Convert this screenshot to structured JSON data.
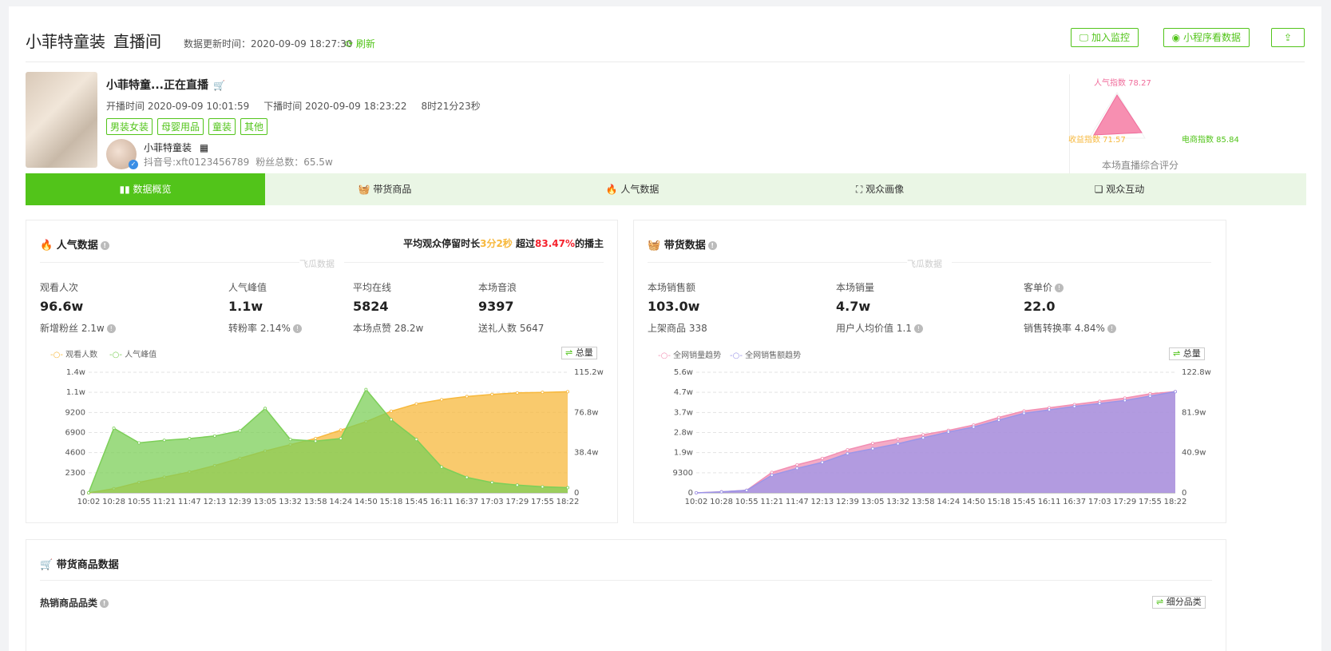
{
  "header": {
    "shop": "小菲特童装",
    "title": "直播间",
    "update_time": "数据更新时间：2020-09-09 18:27:30",
    "refresh": "刷新",
    "btn_monitor": "加入监控",
    "btn_miniapp": "小程序看数据"
  },
  "live": {
    "title": "小菲特童...正在直播",
    "start": "开播时间 2020-09-09 10:01:59",
    "end": "下播时间 2020-09-09 18:23:22",
    "duration": "8时21分23秒",
    "tags": [
      "男装女装",
      "母婴用品",
      "童装",
      "其他"
    ],
    "anchor_name": "小菲特童装",
    "douyin_id": "抖音号:xft0123456789",
    "fans": "粉丝总数：65.5w"
  },
  "radar": {
    "popularity": "人气指数 78.27",
    "revenue": "收益指数 71.57",
    "ecommerce": "电商指数 85.84",
    "caption": "本场直播综合评分"
  },
  "tabs": [
    "数据概览",
    "带货商品",
    "人气数据",
    "观众画像",
    "观众互动"
  ],
  "popularity": {
    "title": "人气数据",
    "summary_prefix": "平均观众停留时长",
    "summary_duration": "3分2秒",
    "summary_mid": " 超过",
    "summary_pct": "83.47%",
    "summary_suffix": "的播主",
    "watermark": "飞瓜数据",
    "metrics": [
      {
        "label": "观看人次",
        "value": "96.6w",
        "sub": "新增粉丝 2.1w"
      },
      {
        "label": "人气峰值",
        "value": "1.1w",
        "sub": "转粉率 2.14%"
      },
      {
        "label": "平均在线",
        "value": "5824",
        "sub": "本场点赞 28.2w"
      },
      {
        "label": "本场音浪",
        "value": "9397",
        "sub": "送礼人数 5647"
      }
    ],
    "legend": [
      "观看人数",
      "人气峰值"
    ],
    "total_btn": "总量"
  },
  "sales": {
    "title": "带货数据",
    "watermark": "飞瓜数据",
    "metrics": [
      {
        "label": "本场销售额",
        "value": "103.0w",
        "sub": "上架商品 338"
      },
      {
        "label": "本场销量",
        "value": "4.7w",
        "sub": "用户人均价值 1.1"
      },
      {
        "label": "客单价",
        "value": "22.0",
        "sub": "销售转换率 4.84%"
      }
    ],
    "legend": [
      "全网销量趋势",
      "全网销售额趋势"
    ],
    "total_btn": "总量"
  },
  "goods": {
    "title": "带货商品数据",
    "subtitle": "热销商品品类",
    "btn": "细分品类"
  },
  "chart_data": [
    {
      "type": "area",
      "title": "人气数据",
      "x": [
        "10:02",
        "10:28",
        "10:55",
        "11:21",
        "11:47",
        "12:13",
        "12:39",
        "13:05",
        "13:32",
        "13:58",
        "14:24",
        "14:50",
        "15:18",
        "15:45",
        "16:11",
        "16:37",
        "17:03",
        "17:29",
        "17:55",
        "18:22"
      ],
      "y_left_ticks": [
        "0",
        "2300",
        "4600",
        "6900",
        "9200",
        "1.1w",
        "1.4w"
      ],
      "y_right_ticks": [
        "0",
        "38.4w",
        "76.8w",
        "115.2w"
      ],
      "series": [
        {
          "name": "人气峰值",
          "axis": "left",
          "color": "#7ccf58",
          "values": [
            0,
            7500,
            5800,
            6100,
            6300,
            6600,
            7200,
            9800,
            6200,
            6000,
            6300,
            12000,
            8500,
            6200,
            3000,
            1800,
            1200,
            900,
            700,
            600
          ]
        },
        {
          "name": "观看人数",
          "axis": "right",
          "color": "#f7b83c",
          "values": [
            0,
            40000,
            100000,
            150000,
            200000,
            260000,
            330000,
            400000,
            460000,
            520000,
            600000,
            680000,
            780000,
            850000,
            890000,
            920000,
            940000,
            955000,
            960000,
            966000
          ]
        }
      ]
    },
    {
      "type": "area",
      "title": "带货数据",
      "x": [
        "10:02",
        "10:28",
        "10:55",
        "11:21",
        "11:47",
        "12:13",
        "12:39",
        "13:05",
        "13:32",
        "13:58",
        "14:24",
        "14:50",
        "15:18",
        "15:45",
        "16:11",
        "16:37",
        "17:03",
        "17:29",
        "17:55",
        "18:22"
      ],
      "y_left_ticks": [
        "0",
        "9300",
        "1.9w",
        "2.8w",
        "3.7w",
        "4.7w",
        "5.6w"
      ],
      "y_right_ticks": [
        "0",
        "40.9w",
        "81.9w",
        "122.8w"
      ],
      "series": [
        {
          "name": "全网销量趋势",
          "axis": "left",
          "color": "#f28fb3",
          "values": [
            0,
            500,
            1200,
            9500,
            13000,
            16000,
            20000,
            23000,
            25000,
            27000,
            29000,
            31500,
            35000,
            38000,
            39500,
            41000,
            42500,
            44000,
            46000,
            47000
          ]
        },
        {
          "name": "全网销售额趋势",
          "axis": "right",
          "color": "#9b95e8",
          "values": [
            0,
            10000,
            25000,
            180000,
            250000,
            310000,
            400000,
            450000,
            500000,
            560000,
            620000,
            670000,
            740000,
            810000,
            845000,
            880000,
            910000,
            940000,
            985000,
            1030000
          ]
        }
      ]
    }
  ]
}
